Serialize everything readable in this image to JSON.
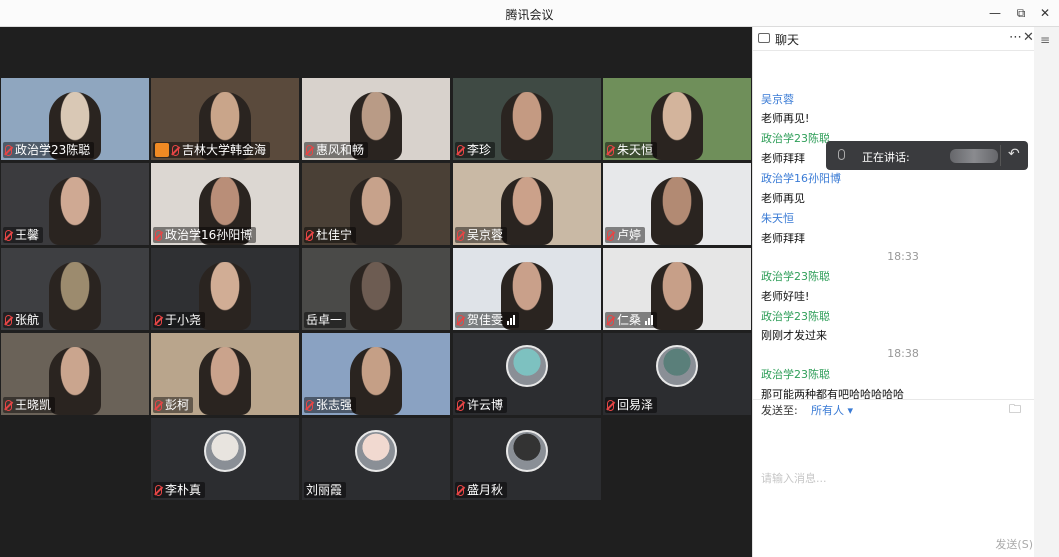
{
  "window": {
    "title": "腾讯会议"
  },
  "window_controls": {
    "minimize": "—",
    "maximize": "⧉",
    "close": "✕"
  },
  "colors": {
    "chat_sender": "#2e9e58",
    "chat_link_blue": "#3a7bd5",
    "video_bg": "#1f1f1f"
  },
  "participants": [
    {
      "name": "政治学23陈聪",
      "mic": "on",
      "row": 1,
      "col": 1
    },
    {
      "name": "吉林大学韩金海",
      "mic": "on",
      "host_icon": true,
      "row": 1,
      "col": 2
    },
    {
      "name": "惠风和畅",
      "mic": "on",
      "row": 1,
      "col": 3
    },
    {
      "name": "李珍",
      "mic": "on",
      "row": 1,
      "col": 4
    },
    {
      "name": "朱天恒",
      "mic": "on",
      "row": 1,
      "col": 5
    },
    {
      "name": "王馨",
      "mic": "on",
      "row": 2,
      "col": 1
    },
    {
      "name": "政治学16孙阳博",
      "mic": "on",
      "row": 2,
      "col": 2
    },
    {
      "name": "杜佳宁",
      "mic": "on",
      "row": 2,
      "col": 3
    },
    {
      "name": "吴京蓉",
      "mic": "on",
      "row": 2,
      "col": 4
    },
    {
      "name": "卢婷",
      "mic": "on",
      "row": 2,
      "col": 5
    },
    {
      "name": "张航",
      "mic": "on",
      "row": 3,
      "col": 1
    },
    {
      "name": "于小尧",
      "mic": "on",
      "row": 3,
      "col": 2
    },
    {
      "name": "岳卓一",
      "mic": "none",
      "row": 3,
      "col": 3
    },
    {
      "name": "贺佳雯",
      "mic": "on",
      "signal": true,
      "row": 3,
      "col": 4
    },
    {
      "name": "仁桑",
      "mic": "on",
      "signal": true,
      "row": 3,
      "col": 5
    },
    {
      "name": "王晓凯",
      "mic": "on",
      "row": 4,
      "col": 1
    },
    {
      "name": "彭柯",
      "mic": "on",
      "row": 4,
      "col": 2
    },
    {
      "name": "张志强",
      "mic": "on",
      "row": 4,
      "col": 3
    },
    {
      "name": "许云博",
      "mic": "on",
      "avatar": true,
      "row": 4,
      "col": 4
    },
    {
      "name": "回易泽",
      "mic": "on",
      "avatar": true,
      "row": 4,
      "col": 5
    },
    {
      "name": "李朴真",
      "mic": "on",
      "avatar": true,
      "row": 5,
      "col": 2
    },
    {
      "name": "刘丽霞",
      "mic": "none",
      "avatar": true,
      "row": 5,
      "col": 3
    },
    {
      "name": "盛月秋",
      "mic": "on",
      "avatar": true,
      "row": 5,
      "col": 4
    }
  ],
  "chat": {
    "title": "聊天",
    "more_icon": "⋯",
    "close_icon": "✕",
    "messages": [
      {
        "kind": "sender",
        "text": "吴京蓉",
        "blue": true
      },
      {
        "kind": "text",
        "text": "老师再见!"
      },
      {
        "kind": "sender",
        "text": "政治学23陈聪"
      },
      {
        "kind": "text",
        "text": "老师拜拜"
      },
      {
        "kind": "sender",
        "text": "政治学16孙阳博",
        "blue": true
      },
      {
        "kind": "text",
        "text": "老师再见"
      },
      {
        "kind": "sender",
        "text": "朱天恒",
        "blue": true
      },
      {
        "kind": "text",
        "text": "老师拜拜"
      },
      {
        "kind": "time",
        "text": "18:33"
      },
      {
        "kind": "sender",
        "text": "政治学23陈聪"
      },
      {
        "kind": "text",
        "text": "老师好哇!"
      },
      {
        "kind": "sender",
        "text": "政治学23陈聪"
      },
      {
        "kind": "text",
        "text": "刚刚才发过来"
      },
      {
        "kind": "time",
        "text": "18:38"
      },
      {
        "kind": "sender",
        "text": "政治学23陈聪"
      },
      {
        "kind": "text",
        "text": "那可能两种都有吧哈哈哈哈哈"
      }
    ],
    "speaking_label": "正在讲话:",
    "send_to_label": "发送至:",
    "send_to_value": "所有人",
    "input_placeholder": "请输入消息...",
    "send_button": "发送(S)"
  }
}
